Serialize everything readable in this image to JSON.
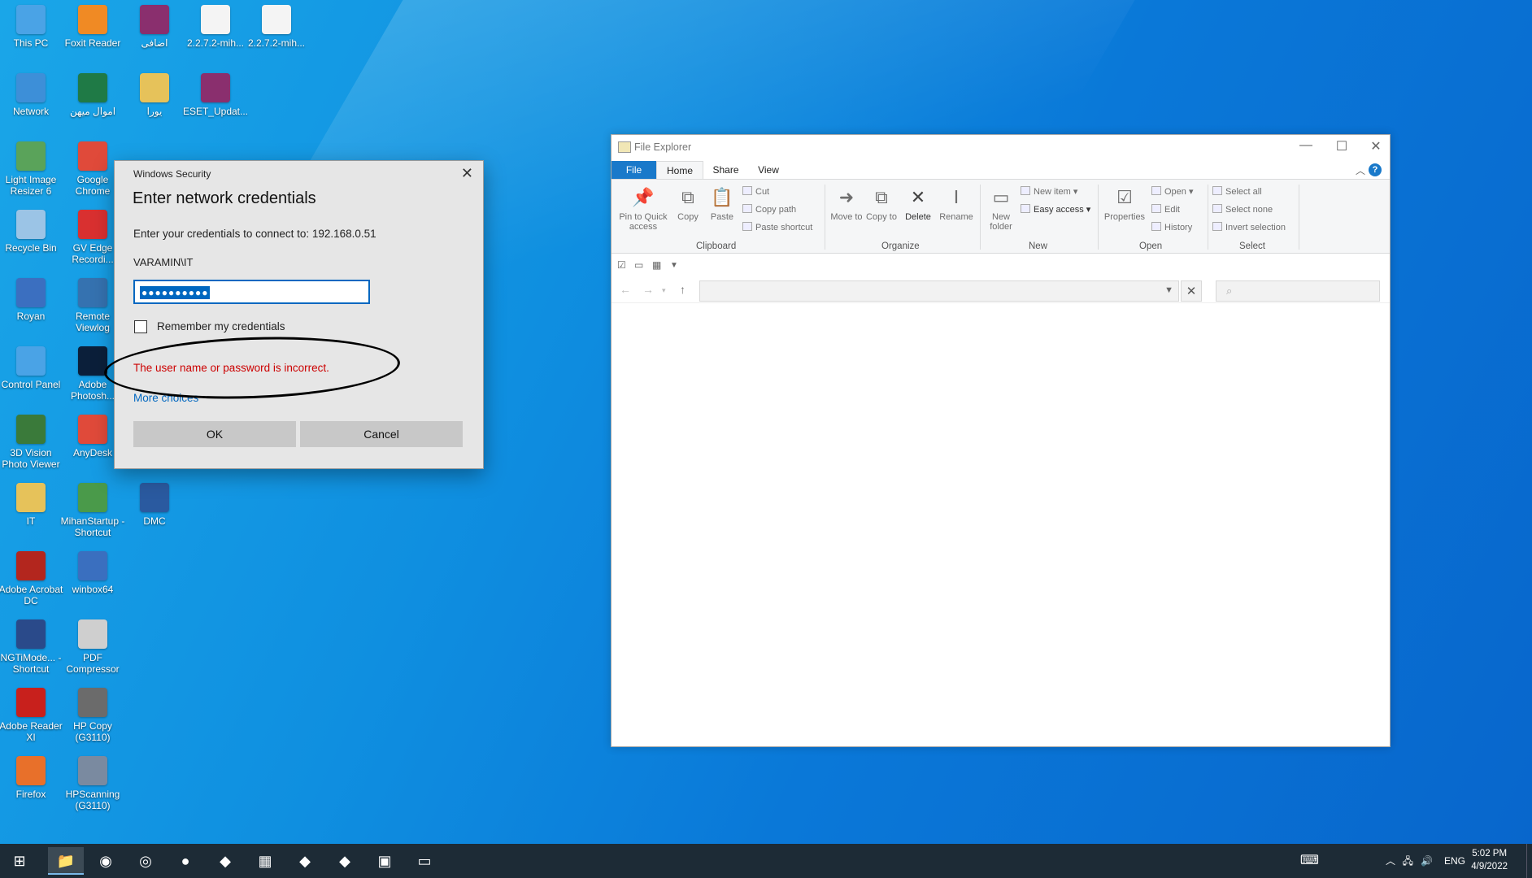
{
  "colors": {
    "accent": "#0067c0",
    "error": "#cc0000",
    "taskbar": "#1d2b36",
    "desktop": "#0a78d8"
  },
  "desktop": {
    "icons": [
      {
        "label": "This PC",
        "icon": "computer-icon",
        "color": "#4aa3e6"
      },
      {
        "label": "Foxit Reader",
        "icon": "foxit-icon",
        "color": "#f08a24"
      },
      {
        "label": "اضافی",
        "icon": "winrar-icon",
        "color": "#8a2f6e"
      },
      {
        "label": "2.2.7.2-mih...",
        "icon": "file-icon",
        "color": "#f4f4f4"
      },
      {
        "label": "2.2.7.2-mih...",
        "icon": "file-icon",
        "color": "#f4f4f4"
      },
      {
        "label": "Network",
        "icon": "network-icon",
        "color": "#3d8fd8"
      },
      {
        "label": "اموال میهن",
        "icon": "excel-icon",
        "color": "#1f7a46"
      },
      {
        "label": "یورا",
        "icon": "folder-zip-icon",
        "color": "#e6c25a"
      },
      {
        "label": "ESET_Updat...",
        "icon": "winrar-icon",
        "color": "#8a2f6e"
      },
      {
        "label": "Light Image Resizer 6",
        "icon": "image-resizer-icon",
        "color": "#5aa35a"
      },
      {
        "label": "Google Chrome",
        "icon": "chrome-icon",
        "color": "#e04a3a"
      },
      {
        "label": "Recycle Bin",
        "icon": "recycle-bin-icon",
        "color": "#9bc4e6"
      },
      {
        "label": "GV Edge Recordi...",
        "icon": "gv-edge-icon",
        "color": "#d93030"
      },
      {
        "label": "Royan",
        "icon": "shortcut-icon",
        "color": "#3b6fc0"
      },
      {
        "label": "Remote Viewlog",
        "icon": "remote-viewlog-icon",
        "color": "#3572b0"
      },
      {
        "label": "Control Panel",
        "icon": "control-panel-icon",
        "color": "#4aa3e6"
      },
      {
        "label": "Adobe Photosh...",
        "icon": "photoshop-icon",
        "color": "#0b1f3a"
      },
      {
        "label": "3D Vision Photo Viewer",
        "icon": "3d-vision-icon",
        "color": "#3a7a3a"
      },
      {
        "label": "AnyDesk",
        "icon": "anydesk-icon",
        "color": "#e04a3a"
      },
      {
        "label": "IT",
        "icon": "folder-user-icon",
        "color": "#e6c25a"
      },
      {
        "label": "MihanStartup - Shortcut",
        "icon": "mihanstartup-icon",
        "color": "#4a9a4a"
      },
      {
        "label": "DMC",
        "icon": "dmc-icon",
        "color": "#2a5aa0"
      },
      {
        "label": "Adobe Acrobat DC",
        "icon": "acrobat-icon",
        "color": "#b3261e"
      },
      {
        "label": "winbox64",
        "icon": "winbox-icon",
        "color": "#3a6fbf"
      },
      {
        "label": "NGTiMode... - Shortcut",
        "icon": "ngti-icon",
        "color": "#2a4a8a"
      },
      {
        "label": "PDF Compressor",
        "icon": "pdf-compressor-icon",
        "color": "#cfcfcf"
      },
      {
        "label": "Adobe Reader XI",
        "icon": "adobe-reader-icon",
        "color": "#c8201c"
      },
      {
        "label": "HP Copy (G3110)",
        "icon": "hp-copy-icon",
        "color": "#6b6b6b"
      },
      {
        "label": "Firefox",
        "icon": "firefox-icon",
        "color": "#e8702a"
      },
      {
        "label": "HPScanning (G3110)",
        "icon": "hp-scan-icon",
        "color": "#7a8aa0"
      }
    ]
  },
  "dialog": {
    "title": "Windows Security",
    "heading": "Enter network credentials",
    "prompt": "Enter your credentials to connect to: 192.168.0.51",
    "username": "VARAMIN\\IT",
    "password_mask": "●●●●●●●●●●",
    "remember_label": "Remember my credentials",
    "error": "The user name or password is incorrect.",
    "more_choices": "More choices",
    "ok": "OK",
    "cancel": "Cancel"
  },
  "explorer": {
    "title": "File Explorer",
    "tabs": [
      "File",
      "Home",
      "Share",
      "View"
    ],
    "ribbon": {
      "pin": "Pin to Quick access",
      "copy": "Copy",
      "paste": "Paste",
      "cut": "Cut",
      "copy_path": "Copy path",
      "paste_shortcut": "Paste shortcut",
      "move_to": "Move to",
      "copy_to": "Copy to",
      "delete": "Delete",
      "rename": "Rename",
      "new_folder": "New folder",
      "new_item": "New item",
      "easy_access": "Easy access",
      "properties": "Properties",
      "open": "Open",
      "edit": "Edit",
      "history": "History",
      "select_all": "Select all",
      "select_none": "Select none",
      "invert_selection": "Invert selection",
      "groups": {
        "clipboard": "Clipboard",
        "organize": "Organize",
        "new": "New",
        "open": "Open",
        "select": "Select"
      }
    },
    "address": "",
    "search_placeholder": ""
  },
  "taskbar": {
    "items": [
      {
        "name": "start-button",
        "icon": "windows-icon"
      },
      {
        "name": "file-explorer",
        "icon": "folder-icon"
      },
      {
        "name": "firefox",
        "icon": "firefox-icon"
      },
      {
        "name": "chrome",
        "icon": "chrome-icon"
      },
      {
        "name": "gv-edge",
        "icon": "gv-edge-icon"
      },
      {
        "name": "app-5",
        "icon": "app-icon"
      },
      {
        "name": "calculator",
        "icon": "calculator-icon"
      },
      {
        "name": "app-7",
        "icon": "app-icon"
      },
      {
        "name": "app-8",
        "icon": "app-icon"
      },
      {
        "name": "control-panel",
        "icon": "control-panel-icon"
      },
      {
        "name": "command-prompt",
        "icon": "terminal-icon"
      }
    ],
    "lang": "ENG",
    "time": "5:02 PM",
    "date": "4/9/2022"
  }
}
